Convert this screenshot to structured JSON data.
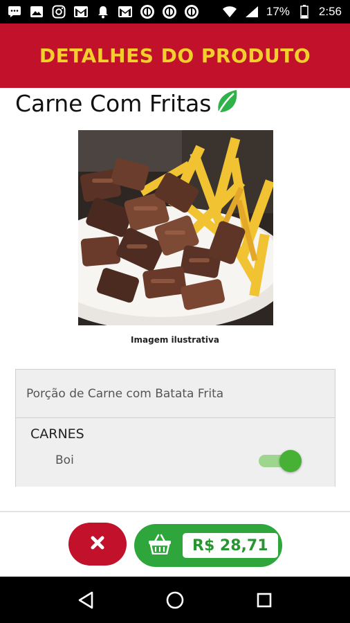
{
  "status_bar": {
    "battery": "17%",
    "time": "2:56"
  },
  "header": {
    "title": "DETALHES DO PRODUTO"
  },
  "product": {
    "name": "Carne Com Fritas",
    "badge_icon": "leaf-icon",
    "image_caption": "Imagem ilustrativa",
    "description": "Porção de Carne com Batata Frita"
  },
  "options": {
    "section_title": "CARNES",
    "items": [
      {
        "label": "Boi",
        "enabled": true
      }
    ]
  },
  "actions": {
    "cancel_icon": "close-icon",
    "cart_icon": "basket-icon",
    "price": "R$ 28,71"
  },
  "colors": {
    "header_bg": "#c1112b",
    "header_text": "#f3cf2c",
    "accent_green": "#2ea63c",
    "cancel_red": "#c1112b"
  }
}
